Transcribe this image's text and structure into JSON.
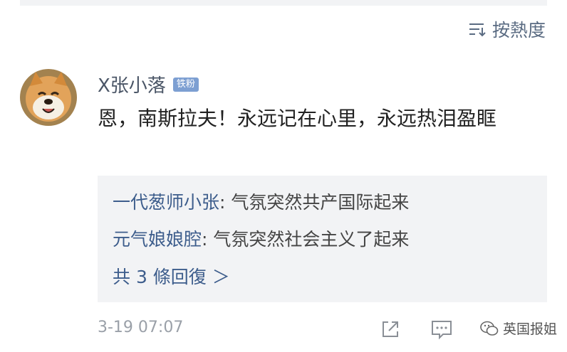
{
  "sort": {
    "label": "按熱度",
    "icon": "sort-icon"
  },
  "comment": {
    "username": "X张小落",
    "badge": "铁粉",
    "text": "恩，南斯拉夫！永远记在心里，永远热泪盈眶",
    "time": "3-19 07:07"
  },
  "replies": [
    {
      "user": "一代葱师小张",
      "text": ": 气氛突然共产国际起来"
    },
    {
      "user": "元气娘娘腔",
      "text": ": 气氛突然社会主义了起来"
    }
  ],
  "more_replies": "共 3 條回復 ＞",
  "actions": [
    "share-icon",
    "comment-icon",
    "like-icon"
  ],
  "watermark": "英国报姐",
  "colors": {
    "link": "#3d5d8c",
    "badge": "#7d9fd2",
    "reply_bg": "#f2f3f5"
  }
}
